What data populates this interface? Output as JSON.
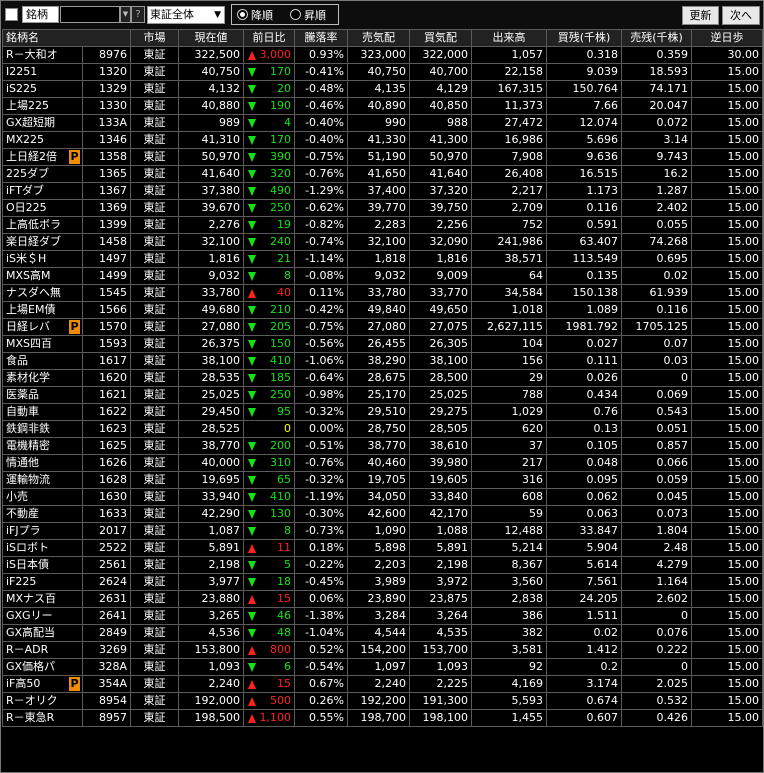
{
  "toolbar": {
    "field_label": "銘柄",
    "code_value": "",
    "help_label": "?",
    "market_value": "東証全体",
    "sort_desc_label": "降順",
    "sort_asc_label": "昇順",
    "sort_selected": "desc",
    "refresh_label": "更新",
    "next_label": "次へ"
  },
  "columns": [
    "銘柄名",
    "市場",
    "現在値",
    "前日比",
    "騰落率",
    "売気配",
    "買気配",
    "出来高",
    "買残(千株)",
    "売残(千株)",
    "逆日歩"
  ],
  "rows": [
    {
      "name": "R－大和オ",
      "code": "8976",
      "market": "東証",
      "price": "322,500",
      "dir": "up",
      "change": "3,000",
      "rate": "0.93%",
      "ask": "323,000",
      "bid": "322,000",
      "volume": "1,057",
      "buy_bal": "0.318",
      "sell_bal": "0.359",
      "rev": "30.00",
      "badge": ""
    },
    {
      "name": "I2251",
      "code": "1320",
      "market": "東証",
      "price": "40,750",
      "dir": "down",
      "change": "170",
      "rate": "-0.41%",
      "ask": "40,750",
      "bid": "40,700",
      "volume": "22,158",
      "buy_bal": "9.039",
      "sell_bal": "18.593",
      "rev": "15.00",
      "badge": ""
    },
    {
      "name": "iS225",
      "code": "1329",
      "market": "東証",
      "price": "4,132",
      "dir": "down",
      "change": "20",
      "rate": "-0.48%",
      "ask": "4,135",
      "bid": "4,129",
      "volume": "167,315",
      "buy_bal": "150.764",
      "sell_bal": "74.171",
      "rev": "15.00",
      "badge": ""
    },
    {
      "name": "上場225",
      "code": "1330",
      "market": "東証",
      "price": "40,880",
      "dir": "down",
      "change": "190",
      "rate": "-0.46%",
      "ask": "40,890",
      "bid": "40,850",
      "volume": "11,373",
      "buy_bal": "7.66",
      "sell_bal": "20.047",
      "rev": "15.00",
      "badge": ""
    },
    {
      "name": "GX超短期",
      "code": "133A",
      "market": "東証",
      "price": "989",
      "dir": "down",
      "change": "4",
      "rate": "-0.40%",
      "ask": "990",
      "bid": "988",
      "volume": "27,472",
      "buy_bal": "12.074",
      "sell_bal": "0.072",
      "rev": "15.00",
      "badge": ""
    },
    {
      "name": "MX225",
      "code": "1346",
      "market": "東証",
      "price": "41,310",
      "dir": "down",
      "change": "170",
      "rate": "-0.40%",
      "ask": "41,330",
      "bid": "41,300",
      "volume": "16,986",
      "buy_bal": "5.696",
      "sell_bal": "3.14",
      "rev": "15.00",
      "badge": ""
    },
    {
      "name": "上日経2倍",
      "code": "1358",
      "market": "東証",
      "price": "50,970",
      "dir": "down",
      "change": "390",
      "rate": "-0.75%",
      "ask": "51,190",
      "bid": "50,970",
      "volume": "7,908",
      "buy_bal": "9.636",
      "sell_bal": "9.743",
      "rev": "15.00",
      "badge": "P"
    },
    {
      "name": "225ダブ",
      "code": "1365",
      "market": "東証",
      "price": "41,640",
      "dir": "down",
      "change": "320",
      "rate": "-0.76%",
      "ask": "41,650",
      "bid": "41,640",
      "volume": "26,408",
      "buy_bal": "16.515",
      "sell_bal": "16.2",
      "rev": "15.00",
      "badge": ""
    },
    {
      "name": "iFTダブ",
      "code": "1367",
      "market": "東証",
      "price": "37,380",
      "dir": "down",
      "change": "490",
      "rate": "-1.29%",
      "ask": "37,400",
      "bid": "37,320",
      "volume": "2,217",
      "buy_bal": "1.173",
      "sell_bal": "1.287",
      "rev": "15.00",
      "badge": ""
    },
    {
      "name": "O日225",
      "code": "1369",
      "market": "東証",
      "price": "39,670",
      "dir": "down",
      "change": "250",
      "rate": "-0.62%",
      "ask": "39,770",
      "bid": "39,750",
      "volume": "2,709",
      "buy_bal": "0.116",
      "sell_bal": "2.402",
      "rev": "15.00",
      "badge": ""
    },
    {
      "name": "上高低ボラ",
      "code": "1399",
      "market": "東証",
      "price": "2,276",
      "dir": "down",
      "change": "19",
      "rate": "-0.82%",
      "ask": "2,283",
      "bid": "2,256",
      "volume": "752",
      "buy_bal": "0.591",
      "sell_bal": "0.055",
      "rev": "15.00",
      "badge": ""
    },
    {
      "name": "楽日経ダブ",
      "code": "1458",
      "market": "東証",
      "price": "32,100",
      "dir": "down",
      "change": "240",
      "rate": "-0.74%",
      "ask": "32,100",
      "bid": "32,090",
      "volume": "241,986",
      "buy_bal": "63.407",
      "sell_bal": "74.268",
      "rev": "15.00",
      "badge": ""
    },
    {
      "name": "iS米＄H",
      "code": "1497",
      "market": "東証",
      "price": "1,816",
      "dir": "down",
      "change": "21",
      "rate": "-1.14%",
      "ask": "1,818",
      "bid": "1,816",
      "volume": "38,571",
      "buy_bal": "113.549",
      "sell_bal": "0.695",
      "rev": "15.00",
      "badge": ""
    },
    {
      "name": "MXS高M",
      "code": "1499",
      "market": "東証",
      "price": "9,032",
      "dir": "down",
      "change": "8",
      "rate": "-0.08%",
      "ask": "9,032",
      "bid": "9,009",
      "volume": "64",
      "buy_bal": "0.135",
      "sell_bal": "0.02",
      "rev": "15.00",
      "badge": ""
    },
    {
      "name": "ナスダへ無",
      "code": "1545",
      "market": "東証",
      "price": "33,780",
      "dir": "up",
      "change": "40",
      "rate": "0.11%",
      "ask": "33,780",
      "bid": "33,770",
      "volume": "34,584",
      "buy_bal": "150.138",
      "sell_bal": "61.939",
      "rev": "15.00",
      "badge": ""
    },
    {
      "name": "上場EM債",
      "code": "1566",
      "market": "東証",
      "price": "49,680",
      "dir": "down",
      "change": "210",
      "rate": "-0.42%",
      "ask": "49,840",
      "bid": "49,650",
      "volume": "1,018",
      "buy_bal": "1.089",
      "sell_bal": "0.116",
      "rev": "15.00",
      "badge": ""
    },
    {
      "name": "日経レバ",
      "code": "1570",
      "market": "東証",
      "price": "27,080",
      "dir": "down",
      "change": "205",
      "rate": "-0.75%",
      "ask": "27,080",
      "bid": "27,075",
      "volume": "2,627,115",
      "buy_bal": "1981.792",
      "sell_bal": "1705.125",
      "rev": "15.00",
      "badge": "P"
    },
    {
      "name": "MXS四百",
      "code": "1593",
      "market": "東証",
      "price": "26,375",
      "dir": "down",
      "change": "150",
      "rate": "-0.56%",
      "ask": "26,455",
      "bid": "26,305",
      "volume": "104",
      "buy_bal": "0.027",
      "sell_bal": "0.07",
      "rev": "15.00",
      "badge": ""
    },
    {
      "name": "食品",
      "code": "1617",
      "market": "東証",
      "price": "38,100",
      "dir": "down",
      "change": "410",
      "rate": "-1.06%",
      "ask": "38,290",
      "bid": "38,100",
      "volume": "156",
      "buy_bal": "0.111",
      "sell_bal": "0.03",
      "rev": "15.00",
      "badge": ""
    },
    {
      "name": "素材化学",
      "code": "1620",
      "market": "東証",
      "price": "28,535",
      "dir": "down",
      "change": "185",
      "rate": "-0.64%",
      "ask": "28,675",
      "bid": "28,500",
      "volume": "29",
      "buy_bal": "0.026",
      "sell_bal": "0",
      "rev": "15.00",
      "badge": ""
    },
    {
      "name": "医薬品",
      "code": "1621",
      "market": "東証",
      "price": "25,025",
      "dir": "down",
      "change": "250",
      "rate": "-0.98%",
      "ask": "25,170",
      "bid": "25,025",
      "volume": "788",
      "buy_bal": "0.434",
      "sell_bal": "0.069",
      "rev": "15.00",
      "badge": ""
    },
    {
      "name": "自動車",
      "code": "1622",
      "market": "東証",
      "price": "29,450",
      "dir": "down",
      "change": "95",
      "rate": "-0.32%",
      "ask": "29,510",
      "bid": "29,275",
      "volume": "1,029",
      "buy_bal": "0.76",
      "sell_bal": "0.543",
      "rev": "15.00",
      "badge": ""
    },
    {
      "name": "鉄鋼非鉄",
      "code": "1623",
      "market": "東証",
      "price": "28,525",
      "dir": "flat",
      "change": "0",
      "rate": "0.00%",
      "ask": "28,750",
      "bid": "28,505",
      "volume": "620",
      "buy_bal": "0.13",
      "sell_bal": "0.051",
      "rev": "15.00",
      "badge": ""
    },
    {
      "name": "電機精密",
      "code": "1625",
      "market": "東証",
      "price": "38,770",
      "dir": "down",
      "change": "200",
      "rate": "-0.51%",
      "ask": "38,770",
      "bid": "38,610",
      "volume": "37",
      "buy_bal": "0.105",
      "sell_bal": "0.857",
      "rev": "15.00",
      "badge": ""
    },
    {
      "name": "情通他",
      "code": "1626",
      "market": "東証",
      "price": "40,000",
      "dir": "down",
      "change": "310",
      "rate": "-0.76%",
      "ask": "40,460",
      "bid": "39,980",
      "volume": "217",
      "buy_bal": "0.048",
      "sell_bal": "0.066",
      "rev": "15.00",
      "badge": ""
    },
    {
      "name": "運輸物流",
      "code": "1628",
      "market": "東証",
      "price": "19,695",
      "dir": "down",
      "change": "65",
      "rate": "-0.32%",
      "ask": "19,705",
      "bid": "19,605",
      "volume": "316",
      "buy_bal": "0.095",
      "sell_bal": "0.059",
      "rev": "15.00",
      "badge": ""
    },
    {
      "name": "小売",
      "code": "1630",
      "market": "東証",
      "price": "33,940",
      "dir": "down",
      "change": "410",
      "rate": "-1.19%",
      "ask": "34,050",
      "bid": "33,840",
      "volume": "608",
      "buy_bal": "0.062",
      "sell_bal": "0.045",
      "rev": "15.00",
      "badge": ""
    },
    {
      "name": "不動産",
      "code": "1633",
      "market": "東証",
      "price": "42,290",
      "dir": "down",
      "change": "130",
      "rate": "-0.30%",
      "ask": "42,600",
      "bid": "42,170",
      "volume": "59",
      "buy_bal": "0.063",
      "sell_bal": "0.073",
      "rev": "15.00",
      "badge": ""
    },
    {
      "name": "iFJプラ",
      "code": "2017",
      "market": "東証",
      "price": "1,087",
      "dir": "down",
      "change": "8",
      "rate": "-0.73%",
      "ask": "1,090",
      "bid": "1,088",
      "volume": "12,488",
      "buy_bal": "33.847",
      "sell_bal": "1.804",
      "rev": "15.00",
      "badge": ""
    },
    {
      "name": "iSロボト",
      "code": "2522",
      "market": "東証",
      "price": "5,891",
      "dir": "up",
      "change": "11",
      "rate": "0.18%",
      "ask": "5,898",
      "bid": "5,891",
      "volume": "5,214",
      "buy_bal": "5.904",
      "sell_bal": "2.48",
      "rev": "15.00",
      "badge": ""
    },
    {
      "name": "iS日本債",
      "code": "2561",
      "market": "東証",
      "price": "2,198",
      "dir": "down",
      "change": "5",
      "rate": "-0.22%",
      "ask": "2,203",
      "bid": "2,198",
      "volume": "8,367",
      "buy_bal": "5.614",
      "sell_bal": "4.279",
      "rev": "15.00",
      "badge": ""
    },
    {
      "name": "iF225",
      "code": "2624",
      "market": "東証",
      "price": "3,977",
      "dir": "down",
      "change": "18",
      "rate": "-0.45%",
      "ask": "3,989",
      "bid": "3,972",
      "volume": "3,560",
      "buy_bal": "7.561",
      "sell_bal": "1.164",
      "rev": "15.00",
      "badge": ""
    },
    {
      "name": "MXナス百",
      "code": "2631",
      "market": "東証",
      "price": "23,880",
      "dir": "up",
      "change": "15",
      "rate": "0.06%",
      "ask": "23,890",
      "bid": "23,875",
      "volume": "2,838",
      "buy_bal": "24.205",
      "sell_bal": "2.602",
      "rev": "15.00",
      "badge": ""
    },
    {
      "name": "GXGリー",
      "code": "2641",
      "market": "東証",
      "price": "3,265",
      "dir": "down",
      "change": "46",
      "rate": "-1.38%",
      "ask": "3,284",
      "bid": "3,264",
      "volume": "386",
      "buy_bal": "1.511",
      "sell_bal": "0",
      "rev": "15.00",
      "badge": ""
    },
    {
      "name": "GX高配当",
      "code": "2849",
      "market": "東証",
      "price": "4,536",
      "dir": "down",
      "change": "48",
      "rate": "-1.04%",
      "ask": "4,544",
      "bid": "4,535",
      "volume": "382",
      "buy_bal": "0.02",
      "sell_bal": "0.076",
      "rev": "15.00",
      "badge": ""
    },
    {
      "name": "R－ADR",
      "code": "3269",
      "market": "東証",
      "price": "153,800",
      "dir": "up",
      "change": "800",
      "rate": "0.52%",
      "ask": "154,200",
      "bid": "153,700",
      "volume": "3,581",
      "buy_bal": "1.412",
      "sell_bal": "0.222",
      "rev": "15.00",
      "badge": ""
    },
    {
      "name": "GX価格パ",
      "code": "328A",
      "market": "東証",
      "price": "1,093",
      "dir": "down",
      "change": "6",
      "rate": "-0.54%",
      "ask": "1,097",
      "bid": "1,093",
      "volume": "92",
      "buy_bal": "0.2",
      "sell_bal": "0",
      "rev": "15.00",
      "badge": ""
    },
    {
      "name": "iF高50",
      "code": "354A",
      "market": "東証",
      "price": "2,240",
      "dir": "up",
      "change": "15",
      "rate": "0.67%",
      "ask": "2,240",
      "bid": "2,225",
      "volume": "4,169",
      "buy_bal": "3.174",
      "sell_bal": "2.025",
      "rev": "15.00",
      "badge": "P"
    },
    {
      "name": "R－オリク",
      "code": "8954",
      "market": "東証",
      "price": "192,000",
      "dir": "up",
      "change": "500",
      "rate": "0.26%",
      "ask": "192,200",
      "bid": "191,300",
      "volume": "5,593",
      "buy_bal": "0.674",
      "sell_bal": "0.532",
      "rev": "15.00",
      "badge": ""
    },
    {
      "name": "R－東急R",
      "code": "8957",
      "market": "東証",
      "price": "198,500",
      "dir": "up",
      "change": "1,100",
      "rate": "0.55%",
      "ask": "198,700",
      "bid": "198,100",
      "volume": "1,455",
      "buy_bal": "0.607",
      "sell_bal": "0.426",
      "rev": "15.00",
      "badge": ""
    }
  ]
}
